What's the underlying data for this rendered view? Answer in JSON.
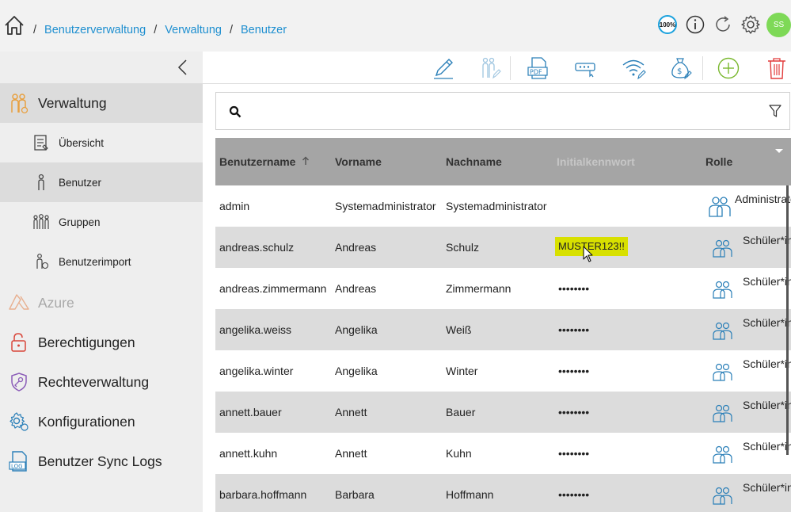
{
  "breadcrumb": {
    "items": [
      "Benutzerverwaltung",
      "Verwaltung",
      "Benutzer"
    ]
  },
  "topbar": {
    "zoom_label": "100%",
    "avatar_initials": "SS",
    "icons": [
      "home-icon",
      "info-icon",
      "refresh-icon",
      "gear-icon"
    ]
  },
  "sidebar": {
    "items": [
      {
        "label": "Verwaltung",
        "icon": "users-admin-icon"
      },
      {
        "label": "Übersicht",
        "icon": "overview-icon"
      },
      {
        "label": "Benutzer",
        "icon": "user-icon"
      },
      {
        "label": "Gruppen",
        "icon": "group-icon"
      },
      {
        "label": "Benutzerimport",
        "icon": "user-import-icon"
      },
      {
        "label": "Azure",
        "icon": "azure-icon"
      },
      {
        "label": "Berechtigungen",
        "icon": "lock-icon"
      },
      {
        "label": "Rechteverwaltung",
        "icon": "key-shield-icon"
      },
      {
        "label": "Konfigurationen",
        "icon": "config-gear-icon"
      },
      {
        "label": "Benutzer Sync Logs",
        "icon": "log-icon"
      }
    ]
  },
  "toolbar": {
    "icons": [
      "edit-icon",
      "users-edit-icon",
      "pdf-icon",
      "password-icon",
      "wifi-icon",
      "money-bag-icon",
      "add-icon",
      "delete-icon"
    ]
  },
  "search": {
    "value": "",
    "placeholder": ""
  },
  "table": {
    "columns": [
      "Benutzername",
      "Vorname",
      "Nachname",
      "Initialkennwort",
      "Rolle"
    ],
    "rows": [
      {
        "username": "admin",
        "firstname": "Systemadministrator",
        "lastname": "Systemadministrator",
        "password": "",
        "role": "Administrator*in"
      },
      {
        "username": "andreas.schulz",
        "firstname": "Andreas",
        "lastname": "Schulz",
        "password": "MUSTER123!!",
        "role": "Schüler*in"
      },
      {
        "username": "andreas.zimmermann",
        "firstname": "Andreas",
        "lastname": "Zimmermann",
        "password": "••••••••",
        "role": "Schüler*in"
      },
      {
        "username": "angelika.weiss",
        "firstname": "Angelika",
        "lastname": "Weiß",
        "password": "••••••••",
        "role": "Schüler*in"
      },
      {
        "username": "angelika.winter",
        "firstname": "Angelika",
        "lastname": "Winter",
        "password": "••••••••",
        "role": "Schüler*in"
      },
      {
        "username": "annett.bauer",
        "firstname": "Annett",
        "lastname": "Bauer",
        "password": "••••••••",
        "role": "Schüler*in"
      },
      {
        "username": "annett.kuhn",
        "firstname": "Annett",
        "lastname": "Kuhn",
        "password": "••••••••",
        "role": "Schüler*in"
      },
      {
        "username": "barbara.hoffmann",
        "firstname": "Barbara",
        "lastname": "Hoffmann",
        "password": "••••••••",
        "role": "Schüler*in"
      }
    ]
  },
  "colors": {
    "link": "#1e8fd0",
    "header": "#a5a5a5",
    "highlight": "#d8e000",
    "avatar": "#7ed957",
    "add": "#7ab82f",
    "delete": "#e23b3b",
    "icon_blue": "#2a7fb8"
  }
}
